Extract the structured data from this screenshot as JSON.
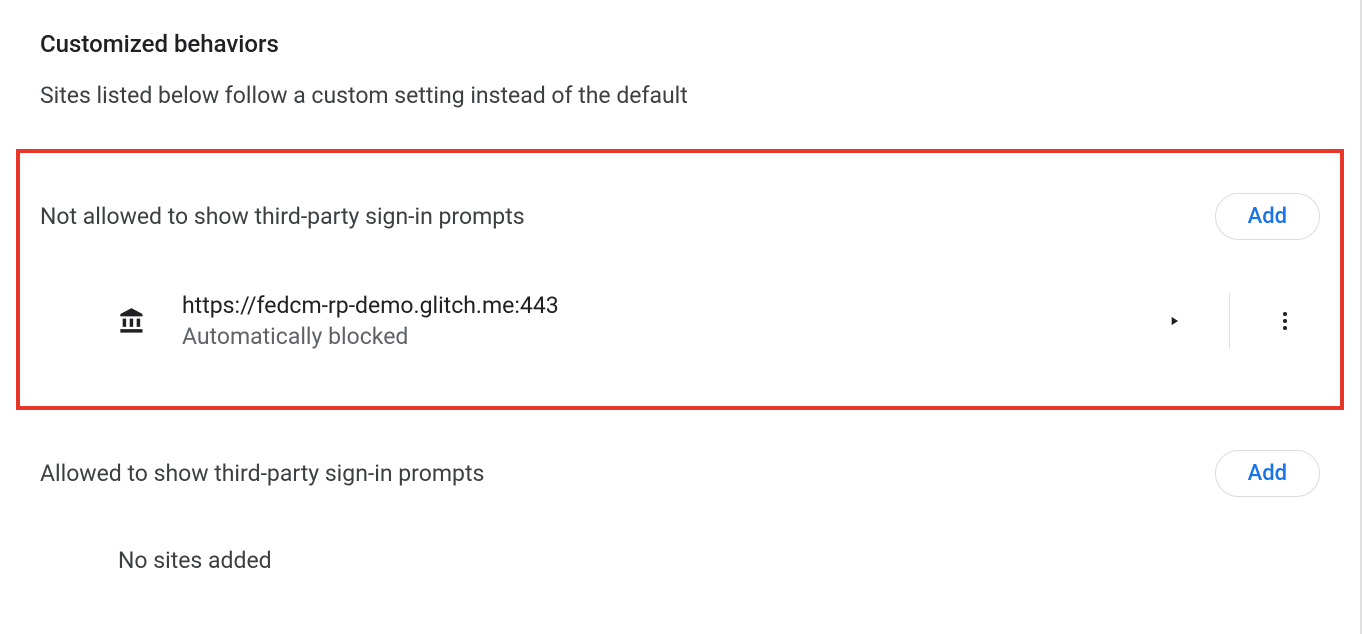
{
  "heading": "Customized behaviors",
  "description": "Sites listed below follow a custom setting instead of the default",
  "not_allowed": {
    "title": "Not allowed to show third-party sign-in prompts",
    "add_label": "Add",
    "sites": [
      {
        "url": "https://fedcm-rp-demo.glitch.me:443",
        "status": "Automatically blocked"
      }
    ]
  },
  "allowed": {
    "title": "Allowed to show third-party sign-in prompts",
    "add_label": "Add",
    "empty_message": "No sites added"
  }
}
